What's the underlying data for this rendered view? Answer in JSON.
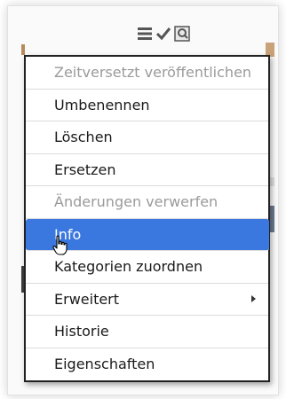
{
  "toolbar": {
    "icons": [
      "list-icon",
      "check-icon",
      "zoom-icon"
    ]
  },
  "menu": {
    "items": [
      {
        "label": "Zeitversetzt veröffentlichen",
        "state": "disabled"
      },
      {
        "label": "Umbenennen",
        "state": "normal"
      },
      {
        "label": "Löschen",
        "state": "normal"
      },
      {
        "label": "Ersetzen",
        "state": "normal"
      },
      {
        "label": "Änderungen verwerfen",
        "state": "disabled"
      },
      {
        "label": "Info",
        "state": "selected"
      },
      {
        "label": "Kategorien zuordnen",
        "state": "normal"
      },
      {
        "label": "Erweitert",
        "state": "normal",
        "submenu": true
      },
      {
        "label": "Historie",
        "state": "normal"
      },
      {
        "label": "Eigenschaften",
        "state": "normal"
      }
    ]
  },
  "colors": {
    "selected_bg": "#3a78e0",
    "disabled_text": "#9a9a9a",
    "menu_border": "#222222"
  }
}
